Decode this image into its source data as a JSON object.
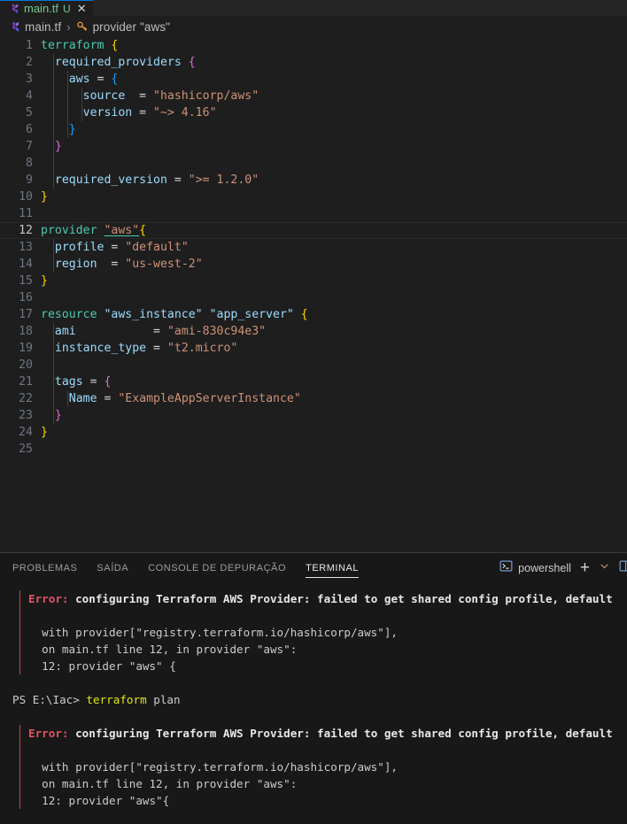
{
  "tab": {
    "filename": "main.tf",
    "badge": "U",
    "close": "✕",
    "icon": "terraform-icon"
  },
  "breadcrumb": {
    "file": "main.tf",
    "separator": "›",
    "symbol": "provider \"aws\"",
    "file_icon": "terraform-icon",
    "symbol_icon": "symbol-key-icon"
  },
  "editor": {
    "language": "terraform",
    "active_line": 12,
    "lines": [
      {
        "n": "1",
        "indent": 0,
        "tokens": [
          {
            "t": "terraform",
            "c": "k"
          },
          {
            "t": " ",
            "c": "op"
          },
          {
            "t": "{",
            "c": "b1"
          }
        ]
      },
      {
        "n": "2",
        "indent": 1,
        "tokens": [
          {
            "t": "  ",
            "c": "op"
          },
          {
            "t": "required_providers",
            "c": "at"
          },
          {
            "t": " ",
            "c": "op"
          },
          {
            "t": "{",
            "c": "b2"
          }
        ]
      },
      {
        "n": "3",
        "indent": 2,
        "tokens": [
          {
            "t": "    ",
            "c": "op"
          },
          {
            "t": "aws",
            "c": "at"
          },
          {
            "t": " = ",
            "c": "op"
          },
          {
            "t": "{",
            "c": "b3"
          }
        ]
      },
      {
        "n": "4",
        "indent": 3,
        "tokens": [
          {
            "t": "      ",
            "c": "op"
          },
          {
            "t": "source",
            "c": "at"
          },
          {
            "t": "  = ",
            "c": "op"
          },
          {
            "t": "\"hashicorp/aws\"",
            "c": "st"
          }
        ]
      },
      {
        "n": "5",
        "indent": 3,
        "tokens": [
          {
            "t": "      ",
            "c": "op"
          },
          {
            "t": "version",
            "c": "at"
          },
          {
            "t": " = ",
            "c": "op"
          },
          {
            "t": "\"~> 4.16\"",
            "c": "st"
          }
        ]
      },
      {
        "n": "6",
        "indent": 2,
        "tokens": [
          {
            "t": "    ",
            "c": "op"
          },
          {
            "t": "}",
            "c": "b3"
          }
        ]
      },
      {
        "n": "7",
        "indent": 1,
        "tokens": [
          {
            "t": "  ",
            "c": "op"
          },
          {
            "t": "}",
            "c": "b2"
          }
        ]
      },
      {
        "n": "8",
        "indent": 1,
        "tokens": []
      },
      {
        "n": "9",
        "indent": 1,
        "tokens": [
          {
            "t": "  ",
            "c": "op"
          },
          {
            "t": "required_version",
            "c": "at"
          },
          {
            "t": " = ",
            "c": "op"
          },
          {
            "t": "\">= 1.2.0\"",
            "c": "st"
          }
        ]
      },
      {
        "n": "10",
        "indent": 0,
        "tokens": [
          {
            "t": "}",
            "c": "b1"
          }
        ]
      },
      {
        "n": "11",
        "indent": 0,
        "tokens": []
      },
      {
        "n": "12",
        "indent": 0,
        "active": true,
        "tokens": [
          {
            "t": "provider ",
            "c": "k"
          },
          {
            "t": "\"aws\"",
            "c": "st uline"
          },
          {
            "t": "{",
            "c": "b1"
          }
        ]
      },
      {
        "n": "13",
        "indent": 1,
        "tokens": [
          {
            "t": "  ",
            "c": "op"
          },
          {
            "t": "profile",
            "c": "at"
          },
          {
            "t": " = ",
            "c": "op"
          },
          {
            "t": "\"default\"",
            "c": "st"
          }
        ]
      },
      {
        "n": "14",
        "indent": 1,
        "tokens": [
          {
            "t": "  ",
            "c": "op"
          },
          {
            "t": "region",
            "c": "at"
          },
          {
            "t": "  = ",
            "c": "op"
          },
          {
            "t": "\"us-west-2\"",
            "c": "st"
          }
        ]
      },
      {
        "n": "15",
        "indent": 0,
        "tokens": [
          {
            "t": "}",
            "c": "b1"
          }
        ]
      },
      {
        "n": "16",
        "indent": 0,
        "tokens": []
      },
      {
        "n": "17",
        "indent": 0,
        "tokens": [
          {
            "t": "resource ",
            "c": "k"
          },
          {
            "t": "\"aws_instance\" \"app_server\"",
            "c": "lbl"
          },
          {
            "t": " ",
            "c": "op"
          },
          {
            "t": "{",
            "c": "b1"
          }
        ]
      },
      {
        "n": "18",
        "indent": 1,
        "tokens": [
          {
            "t": "  ",
            "c": "op"
          },
          {
            "t": "ami",
            "c": "at"
          },
          {
            "t": "           = ",
            "c": "op"
          },
          {
            "t": "\"ami-830c94e3\"",
            "c": "st"
          }
        ]
      },
      {
        "n": "19",
        "indent": 1,
        "tokens": [
          {
            "t": "  ",
            "c": "op"
          },
          {
            "t": "instance_type",
            "c": "at"
          },
          {
            "t": " = ",
            "c": "op"
          },
          {
            "t": "\"t2.micro\"",
            "c": "st"
          }
        ]
      },
      {
        "n": "20",
        "indent": 1,
        "tokens": []
      },
      {
        "n": "21",
        "indent": 1,
        "tokens": [
          {
            "t": "  ",
            "c": "op"
          },
          {
            "t": "tags",
            "c": "at"
          },
          {
            "t": " = ",
            "c": "op"
          },
          {
            "t": "{",
            "c": "b2"
          }
        ]
      },
      {
        "n": "22",
        "indent": 2,
        "tokens": [
          {
            "t": "    ",
            "c": "op"
          },
          {
            "t": "Name",
            "c": "at"
          },
          {
            "t": " = ",
            "c": "op"
          },
          {
            "t": "\"ExampleAppServerInstance\"",
            "c": "st"
          }
        ]
      },
      {
        "n": "23",
        "indent": 1,
        "tokens": [
          {
            "t": "  ",
            "c": "op"
          },
          {
            "t": "}",
            "c": "b2"
          }
        ]
      },
      {
        "n": "24",
        "indent": 0,
        "tokens": [
          {
            "t": "}",
            "c": "b1"
          }
        ]
      },
      {
        "n": "25",
        "indent": 0,
        "tokens": []
      }
    ]
  },
  "panel": {
    "tabs": [
      {
        "label": "PROBLEMAS",
        "active": false
      },
      {
        "label": "SAÍDA",
        "active": false
      },
      {
        "label": "CONSOLE DE DEPURAÇÃO",
        "active": false
      },
      {
        "label": "TERMINAL",
        "active": true
      }
    ],
    "terminal_name": "powershell",
    "terminal_icon": "terminal-icon",
    "new_terminal_label": "+",
    "chevron_label": "˅",
    "split_icon": "split-terminal-icon"
  },
  "terminal": {
    "blocks": [
      {
        "type": "error",
        "error_word": "Error:",
        "headline": " configuring Terraform AWS Provider: failed to get shared config profile, default",
        "details": [
          "  with provider[\"registry.terraform.io/hashicorp/aws\"],",
          "  on main.tf line 12, in provider \"aws\":",
          "  12: provider \"aws\" {"
        ]
      },
      {
        "type": "prompt",
        "path": "PS E:\\Iac>",
        "command": "terraform",
        "args": " plan"
      },
      {
        "type": "error",
        "error_word": "Error:",
        "headline": " configuring Terraform AWS Provider: failed to get shared config profile, default",
        "details": [
          "  with provider[\"registry.terraform.io/hashicorp/aws\"],",
          "  on main.tf line 12, in provider \"aws\":",
          "  12: provider \"aws\"{"
        ]
      }
    ]
  },
  "colors": {
    "editor_bg": "#1e1e1e",
    "panel_bg": "#181818",
    "tab_accent": "#0078d4",
    "modified_green": "#73c991",
    "error_red": "#e05561",
    "keyword_teal": "#4ec9b0",
    "string_orange": "#ce9178",
    "attr_blue": "#9cdcfe"
  }
}
